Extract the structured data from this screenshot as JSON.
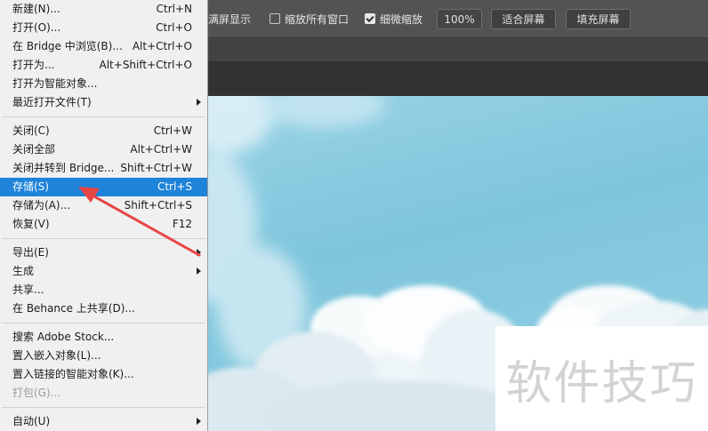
{
  "options_bar": {
    "fullscreen_label": "满屏显示",
    "zoom_all_label": "缩放所有窗口",
    "zoom_all_checked": false,
    "scrubby_label": "细微缩放",
    "scrubby_checked": true,
    "zoom_value": "100%",
    "fit_screen_label": "适合屏幕",
    "fill_screen_label": "填充屏幕"
  },
  "file_menu": {
    "items": [
      {
        "label": "新建(N)...",
        "shortcut": "Ctrl+N"
      },
      {
        "label": "打开(O)...",
        "shortcut": "Ctrl+O"
      },
      {
        "label": "在 Bridge 中浏览(B)...",
        "shortcut": "Alt+Ctrl+O"
      },
      {
        "label": "打开为...",
        "shortcut": "Alt+Shift+Ctrl+O"
      },
      {
        "label": "打开为智能对象...",
        "shortcut": ""
      },
      {
        "label": "最近打开文件(T)",
        "shortcut": "",
        "submenu": true
      },
      {
        "label": "关闭(C)",
        "shortcut": "Ctrl+W"
      },
      {
        "label": "关闭全部",
        "shortcut": "Alt+Ctrl+W"
      },
      {
        "label": "关闭并转到 Bridge...",
        "shortcut": "Shift+Ctrl+W"
      },
      {
        "label": "存储(S)",
        "shortcut": "Ctrl+S",
        "highlighted": true
      },
      {
        "label": "存储为(A)...",
        "shortcut": "Shift+Ctrl+S"
      },
      {
        "label": "恢复(V)",
        "shortcut": "F12"
      },
      {
        "label": "导出(E)",
        "shortcut": "",
        "submenu": true
      },
      {
        "label": "生成",
        "shortcut": "",
        "submenu": true
      },
      {
        "label": "共享...",
        "shortcut": ""
      },
      {
        "label": "在 Behance 上共享(D)...",
        "shortcut": ""
      },
      {
        "label": "搜索 Adobe Stock...",
        "shortcut": ""
      },
      {
        "label": "置入嵌入对象(L)...",
        "shortcut": ""
      },
      {
        "label": "置入链接的智能对象(K)...",
        "shortcut": ""
      },
      {
        "label": "打包(G)...",
        "shortcut": "",
        "disabled": true
      },
      {
        "label": "自动(U)",
        "shortcut": "",
        "submenu": true
      }
    ]
  },
  "watermark": {
    "text": "软件技巧"
  },
  "colors": {
    "menu_bg": "#f0f0f0",
    "highlight": "#1e83d9",
    "options_bar": "#535353",
    "annotation_arrow": "#e84545"
  }
}
